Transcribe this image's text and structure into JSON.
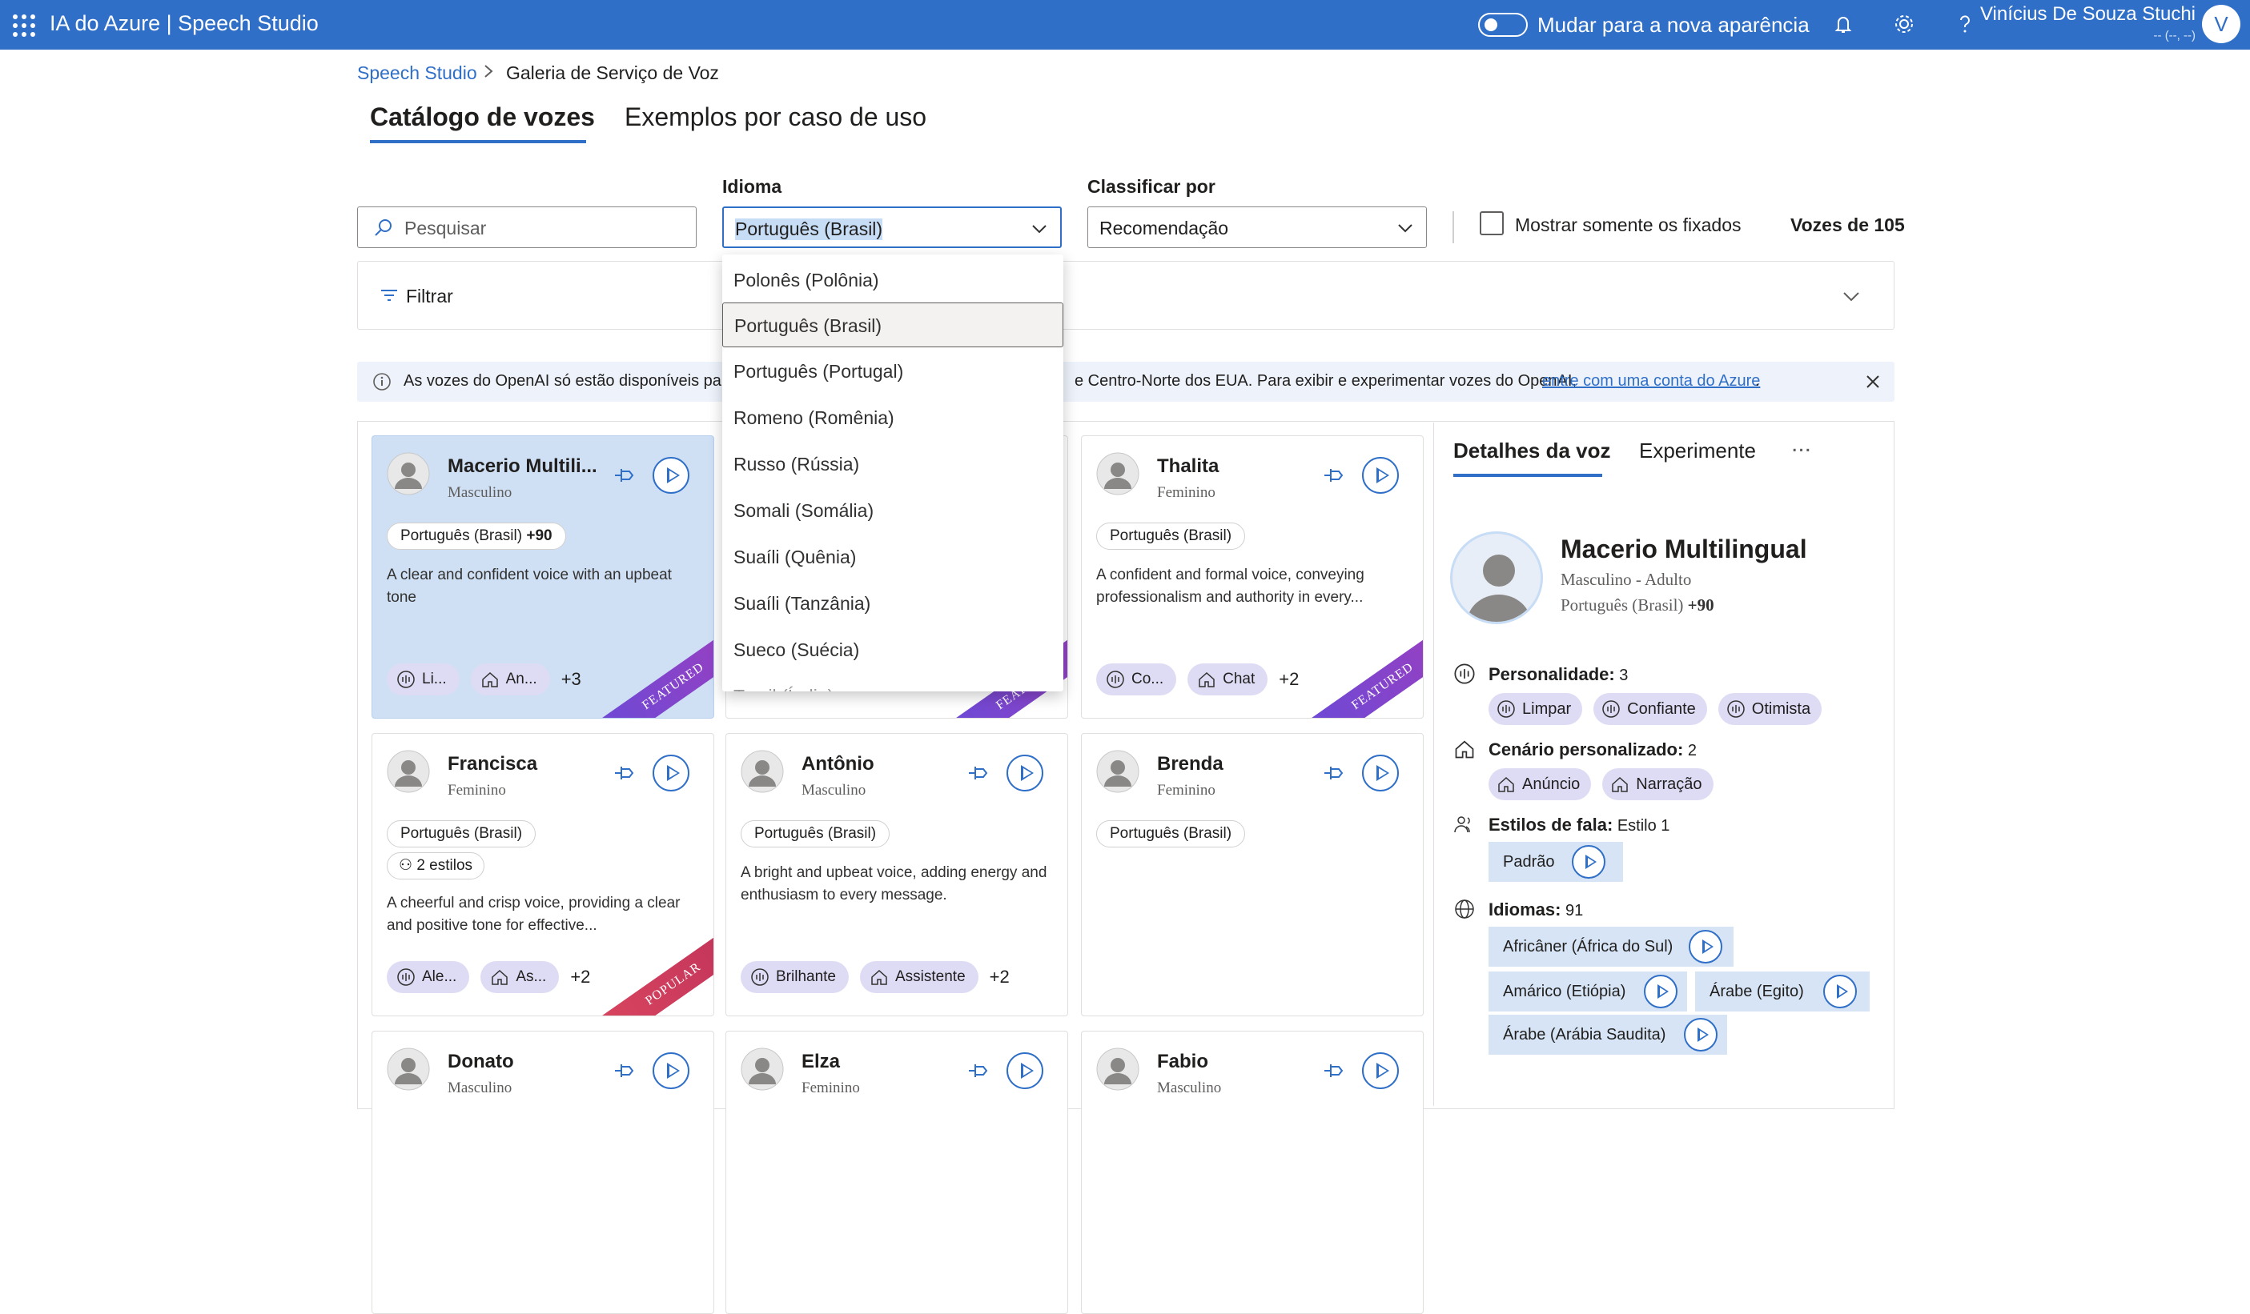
{
  "header": {
    "app_name": "IA do Azure  |  Speech Studio",
    "toggle_label": "Mudar para a nova aparência",
    "user_name": "Vinícius De Souza Stuchi",
    "user_sub": "-- (--, --)",
    "avatar_initial": "V",
    "accent_color": "#2f6fc7"
  },
  "breadcrumb": {
    "root": "Speech Studio",
    "current": "Galeria de Serviço de Voz"
  },
  "tabs": [
    {
      "label": "Catálogo de vozes",
      "active": true
    },
    {
      "label": "Exemplos por caso de uso",
      "active": false
    }
  ],
  "search": {
    "placeholder": "Pesquisar"
  },
  "language": {
    "label": "Idioma",
    "value": "Português (Brasil)"
  },
  "sort": {
    "label": "Classificar por",
    "value": "Recomendação"
  },
  "pinned_only": {
    "label": "Mostrar somente os fixados",
    "checked": false
  },
  "voice_count": "Vozes de 105",
  "filter": {
    "label": "Filtrar"
  },
  "info_banner": {
    "text_start": "As vozes do OpenAI só estão disponíveis para u",
    "text_end": "e Centro-Norte dos EUA. Para exibir e experimentar vozes do OpenAI,",
    "link": "entre com uma conta do Azure",
    "period": "."
  },
  "language_dropdown": [
    "Polonês (Polônia)",
    "Português (Brasil)",
    "Português (Portugal)",
    "Romeno (Romênia)",
    "Russo (Rússia)",
    "Somali (Somália)",
    "Suaíli (Quênia)",
    "Suaíli (Tanzânia)",
    "Sueco (Suécia)",
    "Tamil (Índia)"
  ],
  "cards": [
    {
      "name": "Macerio Multili...",
      "gender": "Masculino",
      "lang": "Português (Brasil)",
      "lang_extra": "+90",
      "desc": "A clear and confident voice with an upbeat tone",
      "tag1": "Li...",
      "tag2": "An...",
      "more": "+3",
      "ribbon": "FEATURED"
    },
    {
      "name": "",
      "gender": "",
      "ribbon": "FEATURED"
    },
    {
      "name": "Thalita",
      "gender": "Feminino",
      "lang": "Português (Brasil)",
      "desc": "A confident and formal voice, conveying professionalism and authority in every...",
      "tag1": "Co...",
      "tag2": "Chat",
      "more": "+2",
      "ribbon": "FEATURED"
    },
    {
      "name": "Francisca",
      "gender": "Feminino",
      "lang": "Português (Brasil)",
      "styles": "2 estilos",
      "desc": "A cheerful and crisp voice, providing a clear and positive tone for effective...",
      "tag1": "Ale...",
      "tag2": "As...",
      "more": "+2",
      "ribbon": "POPULAR"
    },
    {
      "name": "Antônio",
      "gender": "Masculino",
      "lang": "Português (Brasil)",
      "desc": "A bright and upbeat voice, adding energy and enthusiasm to every message.",
      "tag1": "Brilhante",
      "tag2": "Assistente",
      "more": "+2"
    },
    {
      "name": "Brenda",
      "gender": "Feminino",
      "lang": "Português (Brasil)"
    },
    {
      "name": "Donato",
      "gender": "Masculino"
    },
    {
      "name": "Elza",
      "gender": "Feminino"
    },
    {
      "name": "Fabio",
      "gender": "Masculino"
    }
  ],
  "details": {
    "tab1": "Detalhes da voz",
    "tab2": "Experimente",
    "more": "...",
    "name": "Macerio Multilingual",
    "sub": "Masculino - Adulto",
    "lang": "Português (Brasil)",
    "lang_extra": "+90",
    "personality_label": "Personalidade:",
    "personality_count": "3",
    "personality": [
      "Limpar",
      "Confiante",
      "Otimista"
    ],
    "scenario_label": "Cenário personalizado:",
    "scenario_count": "2",
    "scenarios": [
      "Anúncio",
      "Narração"
    ],
    "styles_label": "Estilos de fala:",
    "styles_count": "Estilo 1",
    "style": "Padrão",
    "languages_label": "Idiomas:",
    "languages_count": "91",
    "languages": [
      "Africâner (África do Sul)",
      "Amárico (Etiópia)",
      "Árabe (Egito)",
      "Árabe (Arábia Saudita)"
    ]
  }
}
